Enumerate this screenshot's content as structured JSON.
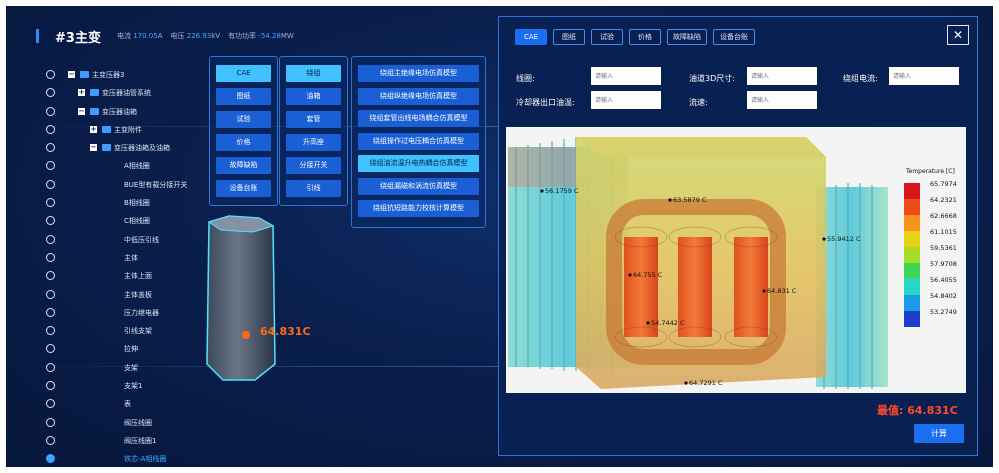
{
  "header": {
    "title": "#3主变",
    "stats": [
      {
        "label": "电流",
        "value": "170.05",
        "unit": "A"
      },
      {
        "label": "电压",
        "value": "226.93",
        "unit": "kV"
      },
      {
        "label": "有功功率",
        "value": "-54.28",
        "unit": "MW"
      }
    ]
  },
  "tree": [
    {
      "label": "主变压器3",
      "level": 1,
      "expand": "−",
      "folder": true
    },
    {
      "label": "变压器油管系统",
      "level": 2,
      "expand": "+",
      "folder": true
    },
    {
      "label": "变压器油箱",
      "level": 2,
      "expand": "−",
      "folder": true
    },
    {
      "label": "主变附件",
      "level": 3,
      "expand": "+",
      "folder": true
    },
    {
      "label": "变压器油箱及油箱",
      "level": 3,
      "expand": "−",
      "folder": true
    },
    {
      "label": "A相线圈",
      "level": 4
    },
    {
      "label": "BUE型有载分接开关",
      "level": 4
    },
    {
      "label": "B相线圈",
      "level": 4
    },
    {
      "label": "C相线圈",
      "level": 4
    },
    {
      "label": "中低压引线",
      "level": 4
    },
    {
      "label": "主体",
      "level": 4
    },
    {
      "label": "主体上面",
      "level": 4
    },
    {
      "label": "主体盖板",
      "level": 4
    },
    {
      "label": "压力继电器",
      "level": 4
    },
    {
      "label": "引线支架",
      "level": 4
    },
    {
      "label": "拉伸",
      "level": 4
    },
    {
      "label": "支架",
      "level": 4
    },
    {
      "label": "支架1",
      "level": 4
    },
    {
      "label": "表",
      "level": 4
    },
    {
      "label": "阀压线圈",
      "level": 4
    },
    {
      "label": "阀压线圈1",
      "level": 4
    },
    {
      "label": "铁芯-A相线圈",
      "level": 4,
      "selected": true
    }
  ],
  "menu1": [
    "CAE",
    "图纸",
    "试验",
    "价格",
    "故障缺陷",
    "设备台账"
  ],
  "menu1_active": 0,
  "menu2": [
    "绕组",
    "油箱",
    "套管",
    "升高座",
    "分接开关",
    "引线"
  ],
  "menu2_active": 0,
  "menu3": [
    "绕组主绝缘电场仿真模型",
    "绕组纵绝缘电场仿真模型",
    "绕组套管出线电场耦合仿真模型",
    "绕组操作过电压耦合仿真模型",
    "绕组油流温升电热耦合仿真模型",
    "绕组漏磁和涡流仿真模型",
    "绕组抗短路能力校核计算模型"
  ],
  "menu3_active": 4,
  "model_temp": "64.831C",
  "modal": {
    "tabs": [
      "CAE",
      "图纸",
      "试验",
      "价格",
      "故障缺陷",
      "设备台账"
    ],
    "active_tab": 0,
    "close": "✕",
    "fields": [
      {
        "label": "线圈:",
        "placeholder": "请输入"
      },
      {
        "label": "油道3D尺寸:",
        "placeholder": "请输入"
      },
      {
        "label": "绕组电流:",
        "placeholder": "请输入"
      },
      {
        "label": "冷却器出口油温:",
        "placeholder": "请输入"
      },
      {
        "label": "流速:",
        "placeholder": "请输入"
      }
    ],
    "legend_title": "Temperature [C]",
    "legend_values": [
      "65.7974",
      "64.2321",
      "62.6668",
      "61.1015",
      "59.5361",
      "57.9708",
      "56.4055",
      "54.8402",
      "53.2749"
    ],
    "legend_colors": [
      "#d6161b",
      "#f04a1a",
      "#f7931e",
      "#e7d21a",
      "#a6dc2a",
      "#3cd65a",
      "#27d8c8",
      "#1c9be8",
      "#1d3fd0"
    ],
    "probes": [
      "56.1759 C",
      "63.5879 C",
      "64.755 C",
      "64.831 C",
      "55.9412 C",
      "54.7442 C",
      "64.7291 C"
    ],
    "max_label": "最值:",
    "max_value": "64.831C",
    "calc_button": "计算"
  },
  "colors": {
    "accent": "#1a6ff0",
    "active_menu": "#3fc2ff",
    "hot": "#ff6a1a"
  }
}
